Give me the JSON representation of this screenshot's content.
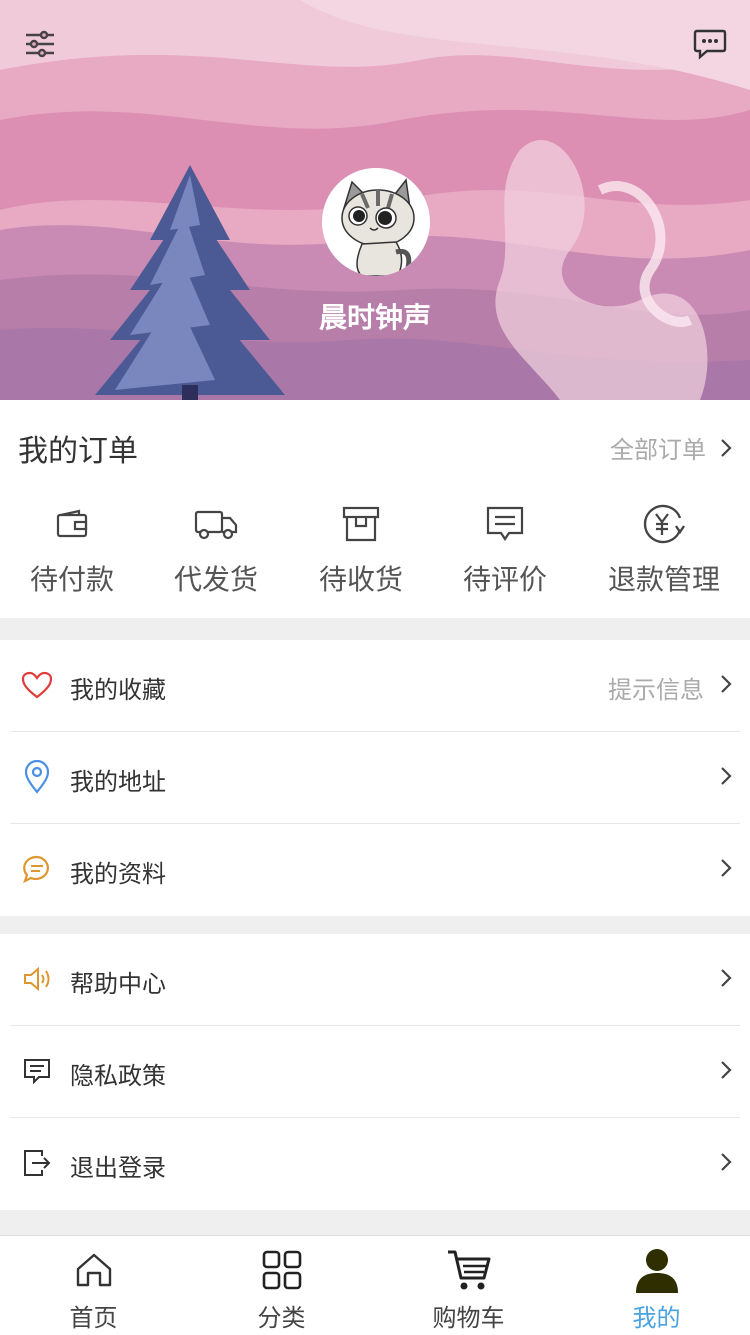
{
  "profile": {
    "username": "晨时钟声"
  },
  "orders": {
    "title": "我的订单",
    "all_label": "全部订单",
    "items": [
      {
        "label": "待付款",
        "icon": "wallet-icon"
      },
      {
        "label": "代发货",
        "icon": "truck-icon"
      },
      {
        "label": "待收货",
        "icon": "box-icon"
      },
      {
        "label": "待评价",
        "icon": "comment-icon"
      },
      {
        "label": "退款管理",
        "icon": "refund-icon"
      }
    ]
  },
  "menu1": {
    "items": [
      {
        "label": "我的收藏",
        "hint": "提示信息",
        "icon": "heart-icon",
        "color": "#e23b3b"
      },
      {
        "label": "我的地址",
        "hint": "",
        "icon": "location-icon",
        "color": "#4a90e2"
      },
      {
        "label": "我的资料",
        "hint": "",
        "icon": "chat-bubble-icon",
        "color": "#e0962e"
      }
    ]
  },
  "menu2": {
    "items": [
      {
        "label": "帮助中心",
        "icon": "speaker-icon",
        "color": "#e0962e"
      },
      {
        "label": "隐私政策",
        "icon": "message-icon",
        "color": "#333333"
      },
      {
        "label": "退出登录",
        "icon": "logout-icon",
        "color": "#333333"
      }
    ]
  },
  "tabbar": {
    "items": [
      {
        "label": "首页",
        "icon": "home-icon"
      },
      {
        "label": "分类",
        "icon": "category-icon"
      },
      {
        "label": "购物车",
        "icon": "cart-icon"
      },
      {
        "label": "我的",
        "icon": "user-icon",
        "active": true
      }
    ]
  },
  "colors": {
    "accent": "#4aa3e0",
    "header_pink": "#e3a1bd",
    "tree": "#3e4e8a"
  }
}
